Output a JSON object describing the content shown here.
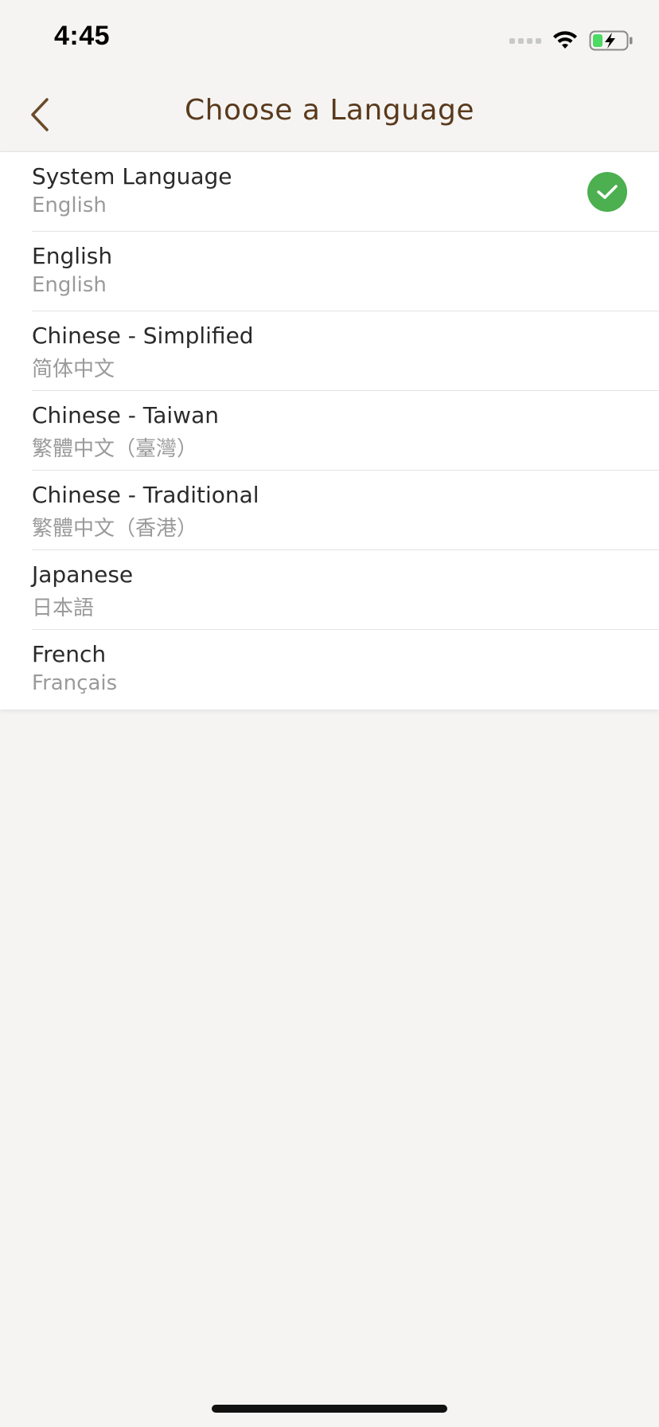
{
  "status_bar": {
    "time": "4:45"
  },
  "nav": {
    "title": "Choose a Language",
    "back_icon": "chevron-left-icon"
  },
  "languages": [
    {
      "name": "System Language",
      "native": "English",
      "selected": true
    },
    {
      "name": "English",
      "native": "English",
      "selected": false
    },
    {
      "name": "Chinese - Simplified",
      "native": "简体中文",
      "selected": false
    },
    {
      "name": "Chinese - Taiwan",
      "native": "繁體中文（臺灣）",
      "selected": false
    },
    {
      "name": "Chinese - Traditional",
      "native": "繁體中文（香港）",
      "selected": false
    },
    {
      "name": "Japanese",
      "native": "日本語",
      "selected": false
    },
    {
      "name": "French",
      "native": "Français",
      "selected": false
    }
  ],
  "colors": {
    "accent": "#5a3a1c",
    "check": "#4caf50",
    "background": "#f5f4f3"
  }
}
